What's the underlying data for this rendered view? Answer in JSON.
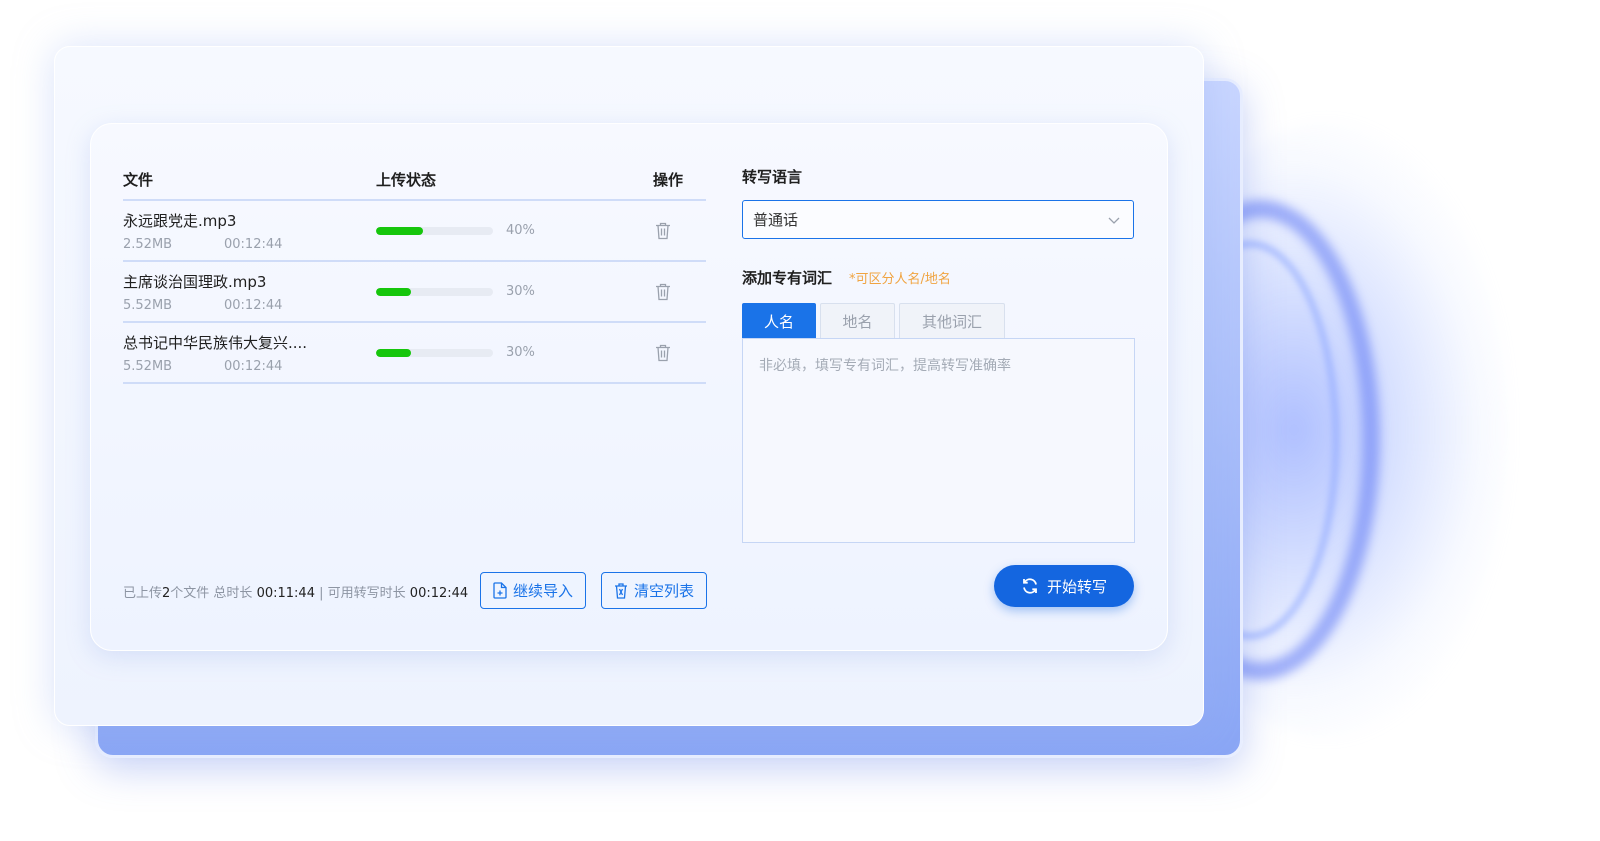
{
  "table": {
    "headers": {
      "file": "文件",
      "status": "上传状态",
      "action": "操作"
    },
    "rows": [
      {
        "name": "永远跟党走.mp3",
        "size": "2.52MB",
        "duration": "00:12:44",
        "progress_pct": 40,
        "progress_label": "40%"
      },
      {
        "name": "主席谈治国理政.mp3",
        "size": "5.52MB",
        "duration": "00:12:44",
        "progress_pct": 30,
        "progress_label": "30%"
      },
      {
        "name": "总书记中华民族伟大复兴....",
        "size": "5.52MB",
        "duration": "00:12:44",
        "progress_pct": 30,
        "progress_label": "30%"
      }
    ]
  },
  "footer": {
    "uploaded_prefix": "已上传",
    "uploaded_count": "2",
    "uploaded_suffix": "个文件 总时长",
    "total_duration": "00:11:44",
    "separator": "|",
    "available_label": "可用转写时长",
    "available_duration": "00:12:44",
    "continue_import": "继续导入",
    "clear_list": "清空列表"
  },
  "language": {
    "label": "转写语言",
    "selected": "普通话"
  },
  "vocab": {
    "label": "添加专有词汇",
    "hint": "*可区分人名/地名",
    "tabs": [
      "人名",
      "地名",
      "其他词汇"
    ],
    "active_tab": 0,
    "placeholder": "非必填，填写专有词汇，提高转写准确率"
  },
  "start_button": "开始转写",
  "colors": {
    "accent": "#1a73e8",
    "progress": "#16c60c",
    "hint": "#f0a441"
  },
  "icons": {
    "delete": "trash-icon",
    "import": "file-add-icon",
    "clear": "trash-icon",
    "start": "refresh-icon",
    "dropdown": "chevron-down-icon"
  }
}
